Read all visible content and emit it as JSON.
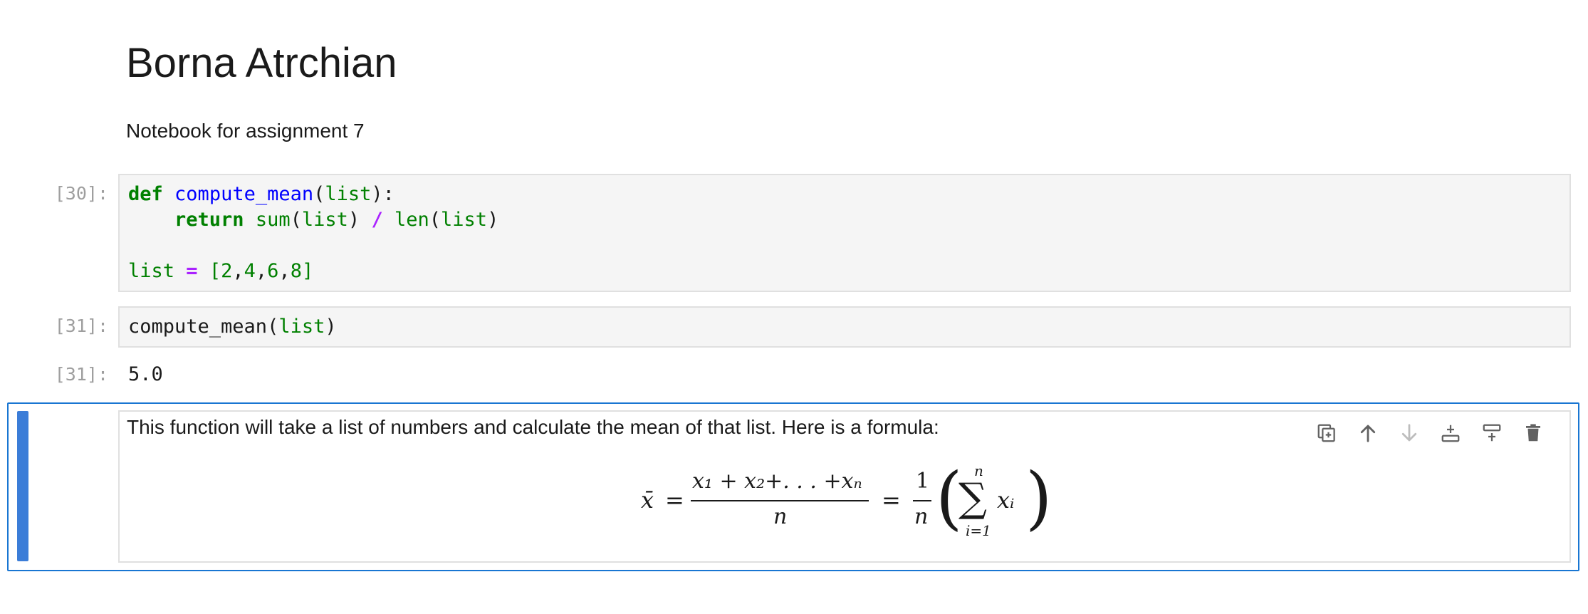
{
  "notebook": {
    "title": "Borna Atrchian",
    "subtitle": "Notebook for assignment 7"
  },
  "cells": {
    "code1": {
      "prompt": "[30]:",
      "line1": {
        "kw": "def",
        "fn": "compute_mean",
        "open": "(",
        "arg": "list",
        "close": "):"
      },
      "line2": {
        "indent": "    ",
        "kw": "return",
        "b1": "sum",
        "p1": "(",
        "a1": "list",
        "p2": ")",
        "op": "/",
        "b2": "len",
        "p3": "(",
        "a2": "list",
        "p4": ")"
      },
      "line4": {
        "var": "list",
        "op": "=",
        "lb": "[",
        "n1": "2",
        "c1": ",",
        "n2": "4",
        "c2": ",",
        "n3": "6",
        "c3": ",",
        "n4": "8",
        "rb": "]"
      }
    },
    "code2": {
      "prompt": "[31]:",
      "fn": "compute_mean",
      "open": "(",
      "arg": "list",
      "close": ")"
    },
    "output": {
      "prompt": "[31]:",
      "value": "5.0"
    },
    "markdown": {
      "text": "This function will take a list of numbers and calculate the mean of that list. Here is a formula:",
      "formula": {
        "xbar": "x̄",
        "eq1": "=",
        "numerator": "x₁ + x₂+. . . +xₙ",
        "denominator": "n",
        "eq2": "=",
        "one": "1",
        "n": "n",
        "lparen": "(",
        "sum_top": "n",
        "sigma": "∑",
        "sum_bottom": "i=1",
        "xi": "xᵢ",
        "rparen": ")"
      }
    }
  },
  "toolbar": {
    "icons": [
      "duplicate-icon",
      "move-up-icon",
      "move-down-icon",
      "insert-above-icon",
      "insert-below-icon",
      "delete-icon"
    ]
  },
  "colors": {
    "accent": "#1976d2",
    "collapser": "#3b7dd8",
    "keyword": "#008000",
    "function": "#0000ff",
    "operator": "#aa22ff"
  }
}
